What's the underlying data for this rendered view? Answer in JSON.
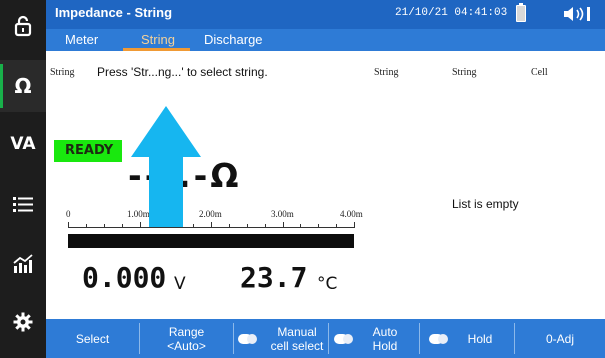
{
  "window": {
    "title": "Impedance - String",
    "datetime": "21/10/21  04:41:03"
  },
  "tabs": [
    {
      "label": "Meter",
      "active": false
    },
    {
      "label": "String",
      "active": true
    },
    {
      "label": "Discharge",
      "active": false
    }
  ],
  "sidebar": {
    "items": [
      {
        "name": "lock",
        "label": ""
      },
      {
        "name": "ohm",
        "label": "Ω"
      },
      {
        "name": "va",
        "label": "VA"
      },
      {
        "name": "list",
        "label": ""
      },
      {
        "name": "chart",
        "label": ""
      },
      {
        "name": "settings",
        "label": ""
      }
    ],
    "active": "ohm"
  },
  "main": {
    "col_string_left": "String",
    "prompt": "Press 'Str...ng...' to select string.",
    "col_string_1": "String",
    "col_string_2": "String",
    "col_cell": "Cell",
    "status": "READY",
    "reading": "---.-Ω",
    "scale": {
      "labels": [
        "0",
        "1.00m",
        "2.00m",
        "3.00m",
        "4.00m"
      ],
      "fill": 1.0
    },
    "voltage_value": "0.000",
    "voltage_unit": "V",
    "temperature_value": "23.7",
    "temperature_unit": "°C",
    "list_empty": "List is empty"
  },
  "function_keys": [
    {
      "line1": "Select",
      "line2": "",
      "toggle": false
    },
    {
      "line1": "Range",
      "line2": "<Auto>",
      "toggle": false
    },
    {
      "line1": "Manual",
      "line2": "cell select",
      "toggle": true
    },
    {
      "line1": "Auto",
      "line2": "Hold",
      "toggle": true
    },
    {
      "line1": "Hold",
      "line2": "",
      "toggle": true
    },
    {
      "line1": "0-Adj",
      "line2": "",
      "toggle": false
    }
  ],
  "colors": {
    "header": "#1f66c2",
    "tabbar": "#2e7bd6",
    "sidebar": "#1d1d1d",
    "ready": "#19e80e",
    "tab_highlight": "#f09a35",
    "arrow": "#16b6f0"
  }
}
